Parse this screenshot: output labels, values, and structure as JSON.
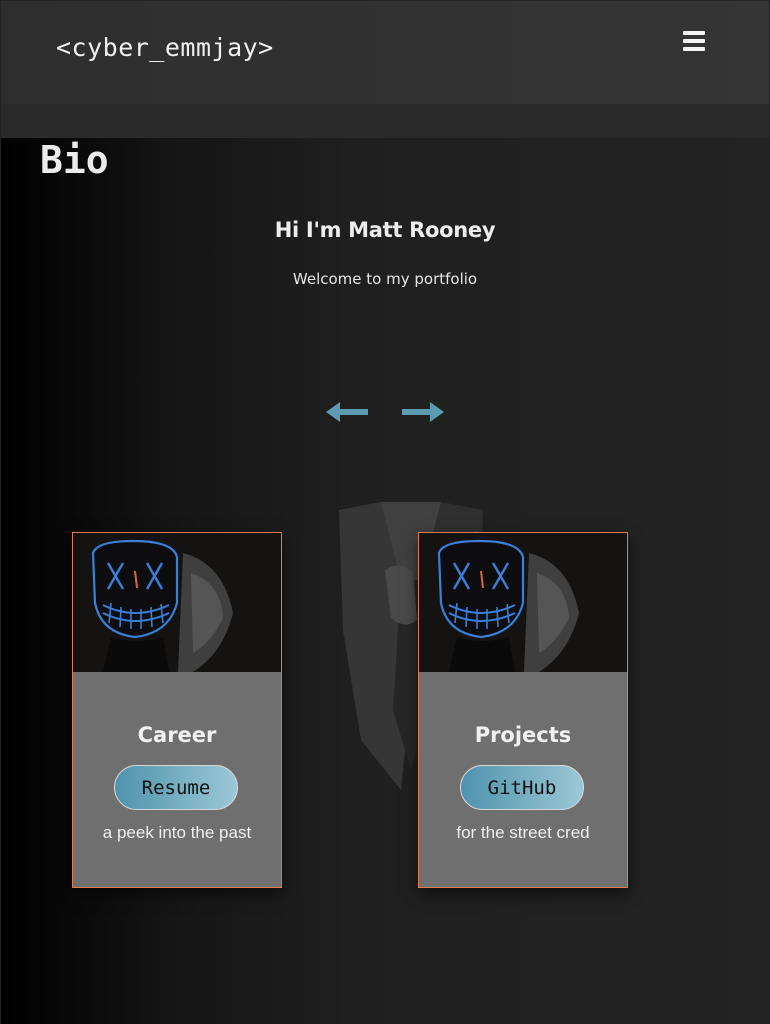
{
  "navbar": {
    "brand": "<cyber_emmjay>",
    "menu_icon": "hamburger-menu-icon"
  },
  "page": {
    "title": "Bio"
  },
  "hero": {
    "title": "Hi I'm Matt Rooney",
    "subtitle": "Welcome to my portfolio",
    "prev_icon": "arrow-left-icon",
    "next_icon": "arrow-right-icon"
  },
  "colors": {
    "accent": "#4f93ad",
    "card_border": "#e07b4f",
    "mask_glow": "#3a7fd8"
  },
  "cards": [
    {
      "title": "Career",
      "button": "Resume",
      "description": "a peek into the past"
    },
    {
      "title": "Projects",
      "button": "GitHub",
      "description": "for the street cred"
    }
  ]
}
